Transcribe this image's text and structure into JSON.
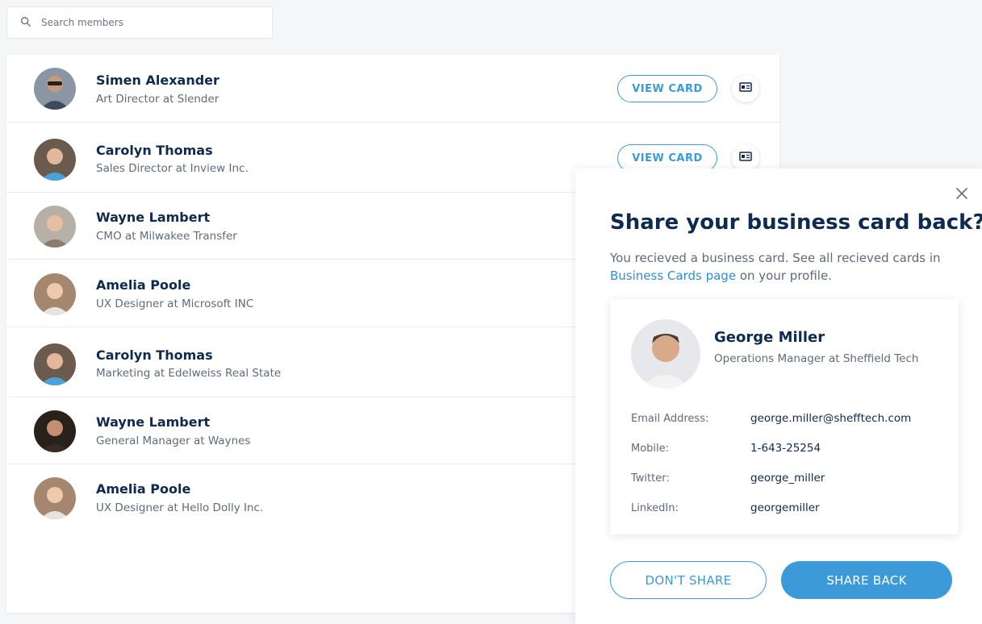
{
  "search": {
    "placeholder": "Search members"
  },
  "members": [
    {
      "name": "Simen Alexander",
      "title": "Art Director at Slender"
    },
    {
      "name": "Carolyn Thomas",
      "title": "Sales Director at Inview Inc."
    },
    {
      "name": "Wayne Lambert",
      "title": "CMO at Milwakee Transfer"
    },
    {
      "name": "Amelia Poole",
      "title": "UX Designer at Microsoft INC"
    },
    {
      "name": "Carolyn Thomas",
      "title": "Marketing at Edelweiss Real State"
    },
    {
      "name": "Wayne Lambert",
      "title": "General Manager at Waynes"
    },
    {
      "name": "Amelia Poole",
      "title": "UX Designer at Hello Dolly Inc."
    }
  ],
  "list": {
    "view_card_label": "VIEW CARD"
  },
  "modal": {
    "title": "Share your business card back?",
    "desc_prefix": "You recieved a business card. See all recieved cards in",
    "desc_link": "Business Cards page",
    "desc_suffix": "on your profile",
    "desc_end": ".",
    "card": {
      "name": "George Miller",
      "role": "Operations Manager at Sheffield Tech",
      "fields": [
        {
          "label": "Email Address:",
          "value": "george.miller@shefftech.com"
        },
        {
          "label": "Mobile:",
          "value": "1-643-25254"
        },
        {
          "label": "Twitter:",
          "value": "george_miller"
        },
        {
          "label": "LinkedIn:",
          "value": "georgemiller"
        }
      ]
    },
    "dont_share_label": "DON'T SHARE",
    "share_back_label": "SHARE BACK"
  },
  "colors": {
    "accent": "#3d9ad8",
    "heading": "#0f2a4f",
    "muted": "#5e6b7a"
  },
  "icons": [
    "search-icon",
    "business-card-icon",
    "close-icon"
  ]
}
